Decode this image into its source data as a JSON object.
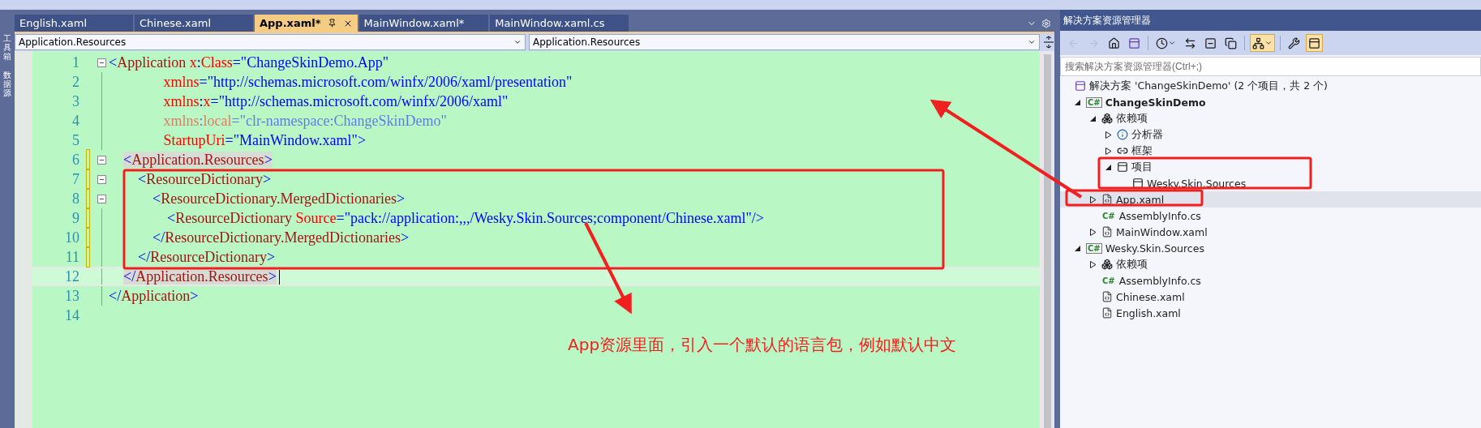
{
  "side_strip": {
    "items": [
      "工具箱",
      "数据源"
    ]
  },
  "tabs": [
    {
      "label": "English.xaml",
      "selected": false
    },
    {
      "label": "Chinese.xaml",
      "selected": false
    },
    {
      "label": "App.xaml*",
      "selected": true
    },
    {
      "label": "MainWindow.xaml*",
      "selected": false
    },
    {
      "label": "MainWindow.xaml.cs",
      "selected": false
    }
  ],
  "nav_bar": {
    "left": "Application.Resources",
    "right": "Application.Resources"
  },
  "editor": {
    "lines": [
      {
        "number": "1",
        "fold": true,
        "tokens": [
          {
            "kind": "punct",
            "text": "<"
          },
          {
            "kind": "element",
            "text": "Application"
          },
          {
            "kind": "attr",
            "text": " x"
          },
          {
            "kind": "punct",
            "text": ":"
          },
          {
            "kind": "attr",
            "text": "Class"
          },
          {
            "kind": "value",
            "text": "=\"ChangeSkinDemo.App\""
          }
        ]
      },
      {
        "number": "2",
        "tokens": [
          {
            "kind": "attr",
            "text": "               xmlns"
          },
          {
            "kind": "value",
            "text": "=\"http://schemas.microsoft.com/winfx/2006/xaml/presentation\""
          }
        ]
      },
      {
        "number": "3",
        "tokens": [
          {
            "kind": "attr",
            "text": "               xmlns"
          },
          {
            "kind": "punct",
            "text": ":"
          },
          {
            "kind": "attr",
            "text": "x"
          },
          {
            "kind": "value",
            "text": "=\"http://schemas.microsoft.com/winfx/2006/xaml\""
          }
        ]
      },
      {
        "number": "4",
        "faded": true,
        "tokens": [
          {
            "kind": "attr",
            "text": "               xmlns"
          },
          {
            "kind": "punct",
            "text": ":"
          },
          {
            "kind": "attr",
            "text": "local"
          },
          {
            "kind": "value",
            "text": "=\"clr-namespace:ChangeSkinDemo\""
          }
        ]
      },
      {
        "number": "5",
        "tokens": [
          {
            "kind": "attr",
            "text": "               StartupUri"
          },
          {
            "kind": "value",
            "text": "=\"MainWindow.xaml\""
          },
          {
            "kind": "punct",
            "text": ">"
          }
        ]
      },
      {
        "number": "6",
        "fold": true,
        "changed": true,
        "matched": true,
        "tokens": [
          {
            "kind": "punct",
            "text": "    <"
          },
          {
            "kind": "element",
            "text": "Application.Resources"
          },
          {
            "kind": "punct",
            "text": ">"
          }
        ]
      },
      {
        "number": "7",
        "fold": true,
        "changed": true,
        "tokens": [
          {
            "kind": "punct",
            "text": "        <"
          },
          {
            "kind": "element",
            "text": "ResourceDictionary"
          },
          {
            "kind": "punct",
            "text": ">"
          }
        ]
      },
      {
        "number": "8",
        "fold": true,
        "changed": true,
        "tokens": [
          {
            "kind": "punct",
            "text": "            <"
          },
          {
            "kind": "element",
            "text": "ResourceDictionary.MergedDictionaries"
          },
          {
            "kind": "punct",
            "text": ">"
          }
        ]
      },
      {
        "number": "9",
        "changed": true,
        "tokens": [
          {
            "kind": "punct",
            "text": "                <"
          },
          {
            "kind": "element",
            "text": "ResourceDictionary"
          },
          {
            "kind": "attr",
            "text": " Source"
          },
          {
            "kind": "value",
            "text": "=\"pack://application:,,,/Wesky.Skin.Sources;component/Chinese.xaml\""
          },
          {
            "kind": "punct",
            "text": "/>"
          }
        ]
      },
      {
        "number": "10",
        "changed": true,
        "tokens": [
          {
            "kind": "punct",
            "text": "            </"
          },
          {
            "kind": "element",
            "text": "ResourceDictionary.MergedDictionaries"
          },
          {
            "kind": "punct",
            "text": ">"
          }
        ]
      },
      {
        "number": "11",
        "changed": true,
        "tokens": [
          {
            "kind": "punct",
            "text": "        </"
          },
          {
            "kind": "element",
            "text": "ResourceDictionary"
          },
          {
            "kind": "punct",
            "text": ">"
          }
        ]
      },
      {
        "number": "12",
        "current": true,
        "matched": true,
        "tokens": [
          {
            "kind": "punct",
            "text": "    </"
          },
          {
            "kind": "element",
            "text": "Application.Resources"
          },
          {
            "kind": "punct",
            "text": ">"
          }
        ]
      },
      {
        "number": "13",
        "tokens": [
          {
            "kind": "punct",
            "text": "</"
          },
          {
            "kind": "element",
            "text": "Application"
          },
          {
            "kind": "punct",
            "text": ">"
          }
        ]
      },
      {
        "number": "14"
      }
    ]
  },
  "annotation": {
    "note": "App资源里面，引入一个默认的语言包，例如默认中文"
  },
  "solution_explorer": {
    "title": "解决方案资源管理器",
    "toolbar": [
      {
        "kind": "back",
        "disabled": true
      },
      {
        "kind": "forward",
        "disabled": true
      },
      {
        "kind": "home",
        "disabled": false
      },
      {
        "kind": "switch",
        "disabled": false
      },
      {
        "kind": "separator"
      },
      {
        "kind": "history",
        "disabled": false,
        "menu": true
      },
      {
        "kind": "sync",
        "disabled": false
      },
      {
        "kind": "collapse",
        "disabled": false
      },
      {
        "kind": "copy",
        "disabled": false
      },
      {
        "kind": "separator"
      },
      {
        "kind": "show-all",
        "disabled": false,
        "pressed": true,
        "menu": true
      },
      {
        "kind": "separator"
      },
      {
        "kind": "properties",
        "disabled": false
      },
      {
        "kind": "preview",
        "disabled": false,
        "pressed": true
      }
    ],
    "search": {
      "placeholder": "搜索解决方案资源管理器(Ctrl+;)"
    },
    "tree": [
      {
        "label": "解决方案 'ChangeSkinDemo' (2 个项目，共 2 个)",
        "kind": "solution",
        "selected": false,
        "children": [
          {
            "label": "ChangeSkinDemo",
            "kind": "csproj",
            "badge": "C#",
            "bold": true,
            "expanded": true,
            "selected": false,
            "children": [
              {
                "label": "依赖项",
                "kind": "deps",
                "expanded": true,
                "selected": false,
                "children": [
                  {
                    "label": "分析器",
                    "kind": "analyzer",
                    "expanded": false,
                    "selected": false
                  },
                  {
                    "label": "框架",
                    "kind": "framework",
                    "expanded": false,
                    "selected": false
                  },
                  {
                    "label": "项目",
                    "kind": "projects",
                    "expanded": true,
                    "selected": false,
                    "children": [
                      {
                        "label": "Wesky.Skin.Sources",
                        "kind": "projref",
                        "selected": false
                      }
                    ]
                  }
                ]
              },
              {
                "label": "App.xaml",
                "kind": "xaml",
                "expanded": false,
                "selected": true
              },
              {
                "label": "AssemblyInfo.cs",
                "kind": "cs",
                "badge": "C#",
                "selected": false
              },
              {
                "label": "MainWindow.xaml",
                "kind": "xaml",
                "expanded": false,
                "selected": false
              }
            ]
          },
          {
            "label": "Wesky.Skin.Sources",
            "kind": "csproj",
            "badge": "C#",
            "bold": false,
            "expanded": true,
            "selected": false,
            "children": [
              {
                "label": "依赖项",
                "kind": "deps",
                "expanded": false,
                "selected": false
              },
              {
                "label": "AssemblyInfo.cs",
                "kind": "cs",
                "badge": "C#",
                "selected": false
              },
              {
                "label": "Chinese.xaml",
                "kind": "xaml",
                "selected": false
              },
              {
                "label": "English.xaml",
                "kind": "xaml",
                "selected": false
              }
            ]
          }
        ]
      }
    ]
  }
}
